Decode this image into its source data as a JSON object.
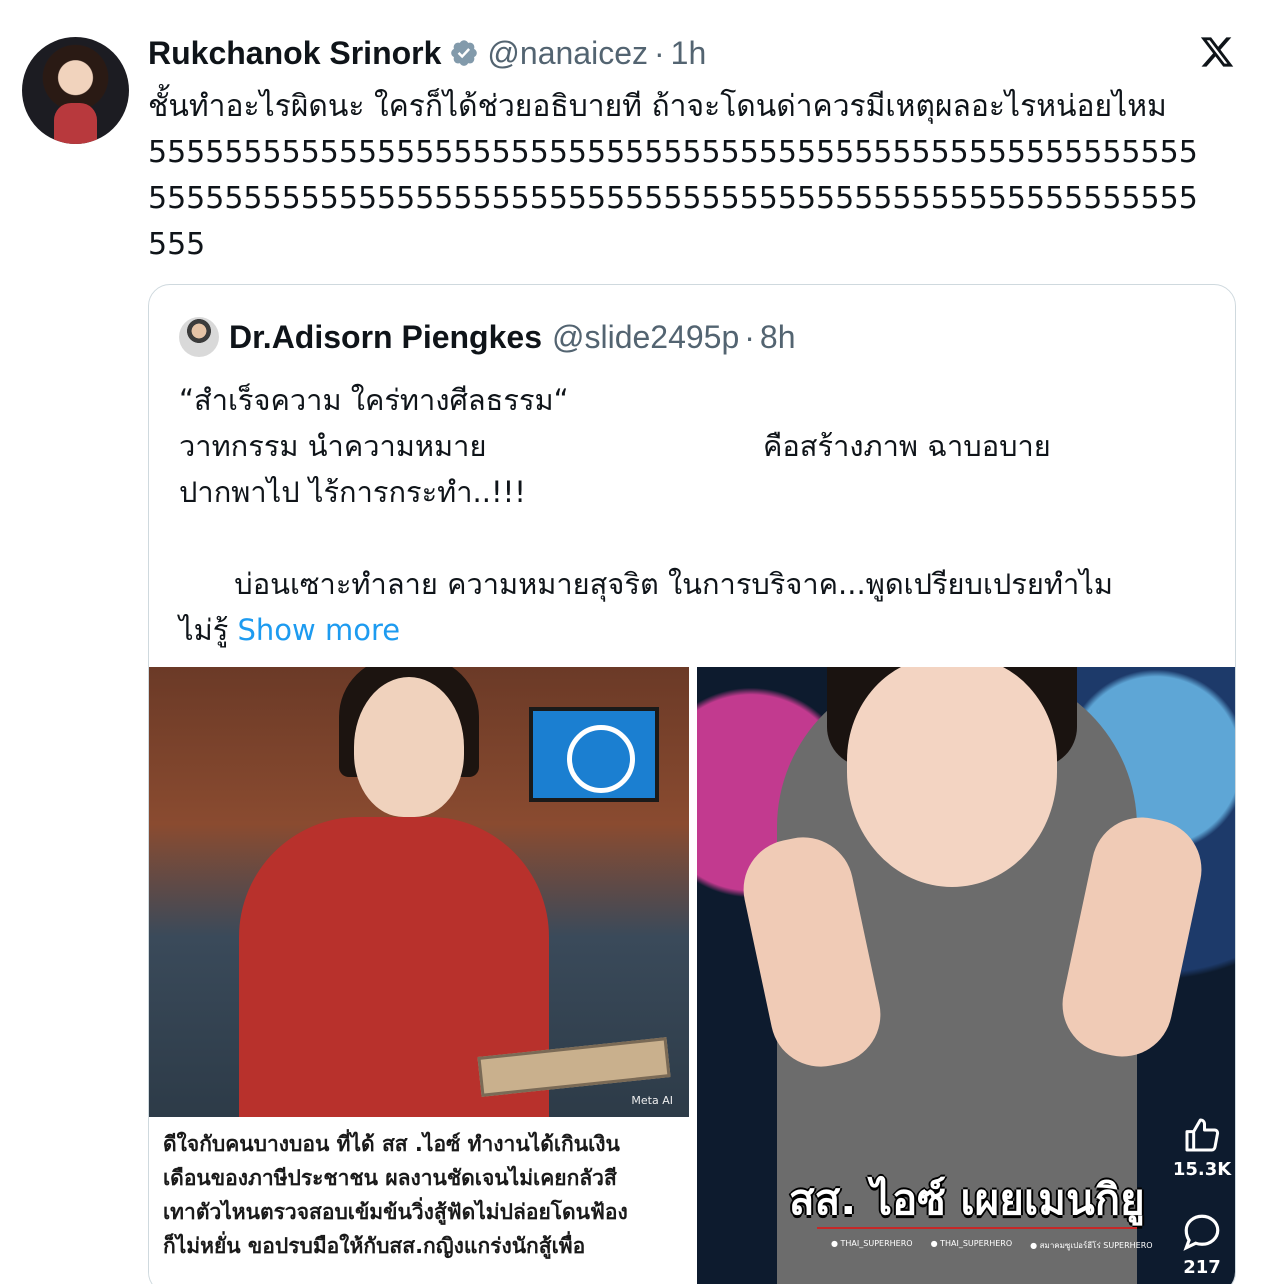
{
  "tweet": {
    "author_name": "Rukchanok Srinork",
    "handle": "@nanaicez",
    "separator": "·",
    "time": "1h",
    "text_lines": [
      "ชั้นทำอะไรผิดนะ ใครก็ได้ช่วยอธิบายที ถ้าจะโดนด่าควรมีเหตุผลอะไรหน่อยไหม",
      "5555555555555555555555555555555555555555555555555555555",
      "5555555555555555555555555555555555555555555555555555555",
      "555"
    ]
  },
  "quote": {
    "author_name": "Dr.Adisorn Piengkes",
    "handle": "@slide2495p",
    "separator": "·",
    "time": "8h",
    "lines": [
      "“สำเร็จความ ใคร่ทางศีลธรรม“",
      "วาทกรรม นำความหมาย                              คือสร้างภาพ ฉาบอบาย",
      "ปากพาไป ไร้การกระทำ..!!!",
      "",
      "      บ่อนเซาะทำลาย ความหมายสุจริต ในการบริจาค...พูดเปรียบเปรยทำไม"
    ],
    "last_line": "ไม่รู้",
    "show_more": "Show more"
  },
  "media": {
    "left": {
      "watermark": "Meta AI",
      "caption_lines": [
        "ดีใจกับคนบางบอน ที่ได้ สส .ไอซ์ ทำงานได้เกินเงิน",
        "เดือนของภาษีประชาชน  ผลงานชัดเจนไม่เคยกลัวสี",
        "เทาตัวไหนตรวจสอบเข้มข้นวิ่งสู้ฟัดไม่ปล่อยโดนฟ้อง",
        "ก็ไม่หยั่น ขอปรบมือให้กับสส.กญิงแกร่งนักสู้เพื่อ"
      ]
    },
    "right": {
      "title": "สส. ไอซ์ เผยเมนกิยู",
      "socials": [
        "THAI_SUPERHERO",
        "THAI_SUPERHERO",
        "สมาคมซูเปอร์ฮีโร่ SUPERHERO"
      ],
      "like_count": "15.3K",
      "comment_count": "217"
    }
  },
  "colors": {
    "text": "#0f1419",
    "secondary": "#536471",
    "link": "#1d9bf0",
    "verified": "#829aab",
    "border": "#cfd9de"
  },
  "icons": {
    "verified": "verified-badge-icon",
    "brand": "x-logo-icon",
    "like": "thumbs-up-icon",
    "comment": "comment-bubble-icon"
  }
}
